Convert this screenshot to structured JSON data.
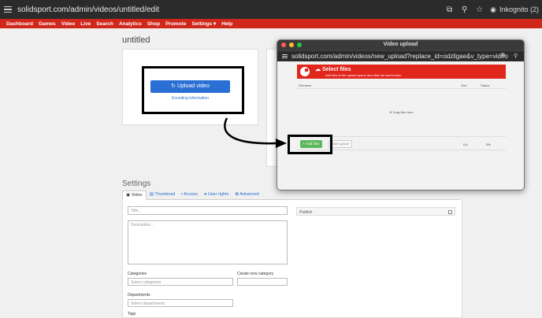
{
  "browser": {
    "url": "solidsport.com/admin/videos/untitled/edit",
    "incognito_label": "Inkognito (2)"
  },
  "nav": {
    "items": [
      "Dashboard",
      "Games",
      "Video",
      "Live",
      "Search",
      "Analytics",
      "Shop",
      "Promote",
      "Settings ▾",
      "Help"
    ]
  },
  "page": {
    "title": "untitled",
    "upload_button": "Upload video",
    "encoding_link": "Encoding information"
  },
  "settings": {
    "title": "Settings",
    "tabs": [
      "Video",
      "Thumbnail",
      "Access",
      "User rights",
      "Advanced"
    ],
    "title_placeholder": "Title...",
    "description_placeholder": "Description...",
    "publish_label": "Publish",
    "categories_label": "Categories",
    "categories_placeholder": "Select categories",
    "new_category_label": "Create new category",
    "departments_label": "Departments",
    "departments_placeholder": "Select departments",
    "tags_label": "Tags"
  },
  "popup": {
    "window_title": "Video upload",
    "url": "solidsport.com/admin/videos/new_upload?replace_id=odzligae&v_type=video",
    "header_title": "Select files",
    "header_subtitle": "Add files to the upload queue and click the start button",
    "col_filename": "Filename",
    "col_size": "Size",
    "col_status": "Status",
    "drop_text": "Drag files here",
    "add_files": "Add files",
    "start_upload": "Start upload",
    "total_size": "0 b",
    "total_status": "0%"
  },
  "colors": {
    "nav_red": "#d0271b",
    "upload_blue": "#2a6fd4",
    "add_green": "#5cb85c"
  }
}
